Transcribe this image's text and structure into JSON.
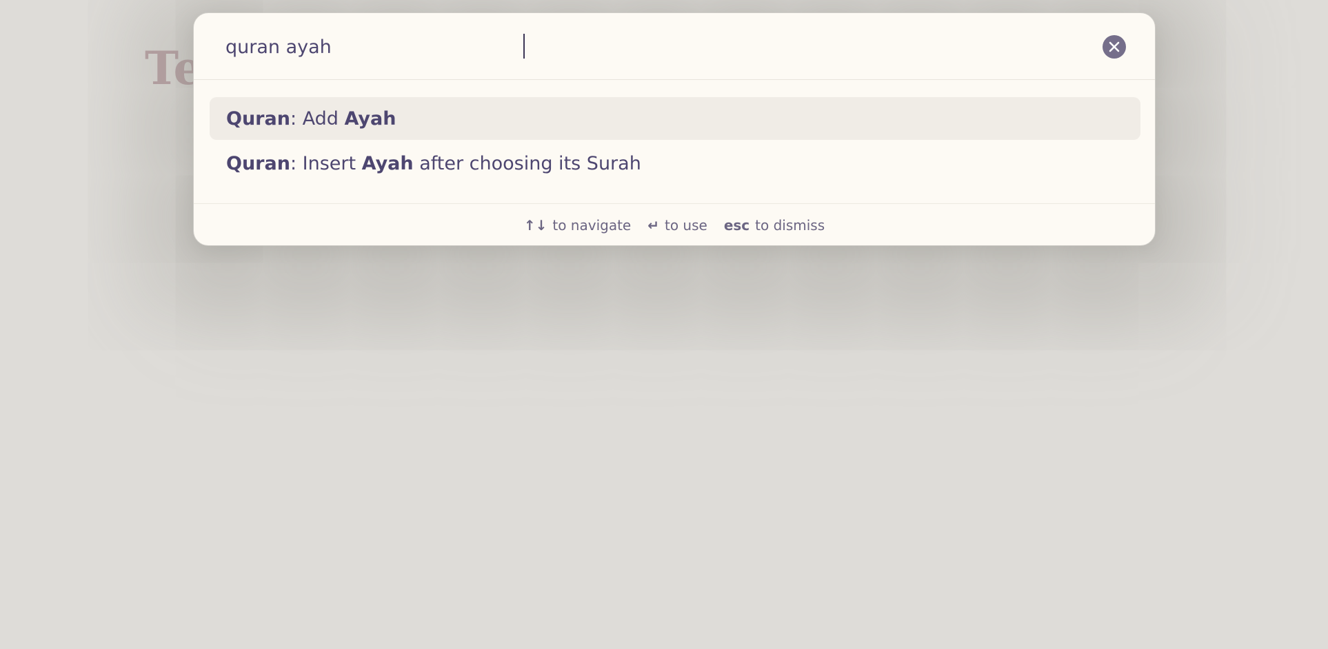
{
  "background": {
    "title_fragment": "Te"
  },
  "search": {
    "value": "quran ayah",
    "clear_icon": "close-icon"
  },
  "suggestions": [
    {
      "parts": [
        {
          "text": "Quran",
          "bold": true
        },
        {
          "text": ": Add ",
          "bold": false
        },
        {
          "text": "Ayah",
          "bold": true
        }
      ],
      "selected": true
    },
    {
      "parts": [
        {
          "text": "Quran",
          "bold": true
        },
        {
          "text": ": Insert ",
          "bold": false
        },
        {
          "text": "Ayah",
          "bold": true
        },
        {
          "text": " after choosing its Surah",
          "bold": false
        }
      ],
      "selected": false
    }
  ],
  "footer": {
    "navigate_key": "↑↓",
    "navigate_label": "to navigate",
    "use_key": "↵",
    "use_label": "to use",
    "dismiss_key": "esc",
    "dismiss_label": "to dismiss"
  },
  "colors": {
    "accent_text": "#4d4670",
    "clear_button": "#756e8a",
    "selected_row": "#f0ece6",
    "title_fragment": "#a8848c"
  }
}
